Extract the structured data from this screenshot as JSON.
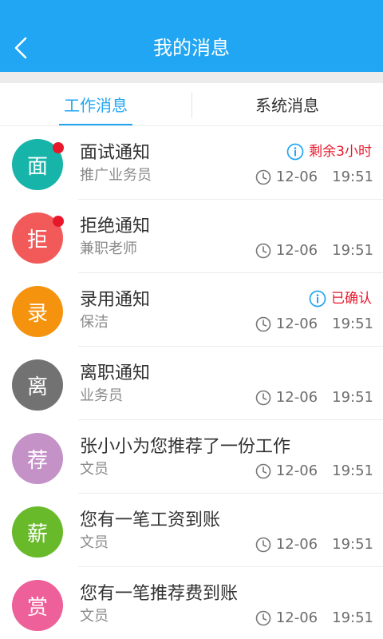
{
  "header": {
    "title": "我的消息",
    "back_icon": "chevron-left-icon"
  },
  "tabs": [
    {
      "label": "工作消息",
      "active": true
    },
    {
      "label": "系统消息",
      "active": false
    }
  ],
  "messages": [
    {
      "avatar_char": "面",
      "avatar_color": "#17b5a9",
      "unread": true,
      "title": "面试通知",
      "subtitle": "推广业务员",
      "status": "剩余3小时",
      "date": "12-06",
      "time": "19:51"
    },
    {
      "avatar_char": "拒",
      "avatar_color": "#f25a5a",
      "unread": true,
      "title": "拒绝通知",
      "subtitle": "兼职老师",
      "status": "",
      "date": "12-06",
      "time": "19:51"
    },
    {
      "avatar_char": "录",
      "avatar_color": "#f6930e",
      "unread": false,
      "title": "录用通知",
      "subtitle": "保洁",
      "status": "已确认",
      "date": "12-06",
      "time": "19:51"
    },
    {
      "avatar_char": "离",
      "avatar_color": "#727272",
      "unread": false,
      "title": "离职通知",
      "subtitle": "业务员",
      "status": "",
      "date": "12-06",
      "time": "19:51"
    },
    {
      "avatar_char": "荐",
      "avatar_color": "#c592c8",
      "unread": false,
      "title": "张小小为您推荐了一份工作",
      "subtitle": "文员",
      "status": "",
      "date": "12-06",
      "time": "19:51"
    },
    {
      "avatar_char": "薪",
      "avatar_color": "#68ba2a",
      "unread": false,
      "title": "您有一笔工资到账",
      "subtitle": "文员",
      "status": "",
      "date": "12-06",
      "time": "19:51"
    },
    {
      "avatar_char": "赏",
      "avatar_color": "#ee6099",
      "unread": false,
      "title": "您有一笔推荐费到账",
      "subtitle": "文员",
      "status": "",
      "date": "12-06",
      "time": "19:51"
    }
  ],
  "colors": {
    "accent": "#21a6f3",
    "alert": "#e8182b"
  }
}
